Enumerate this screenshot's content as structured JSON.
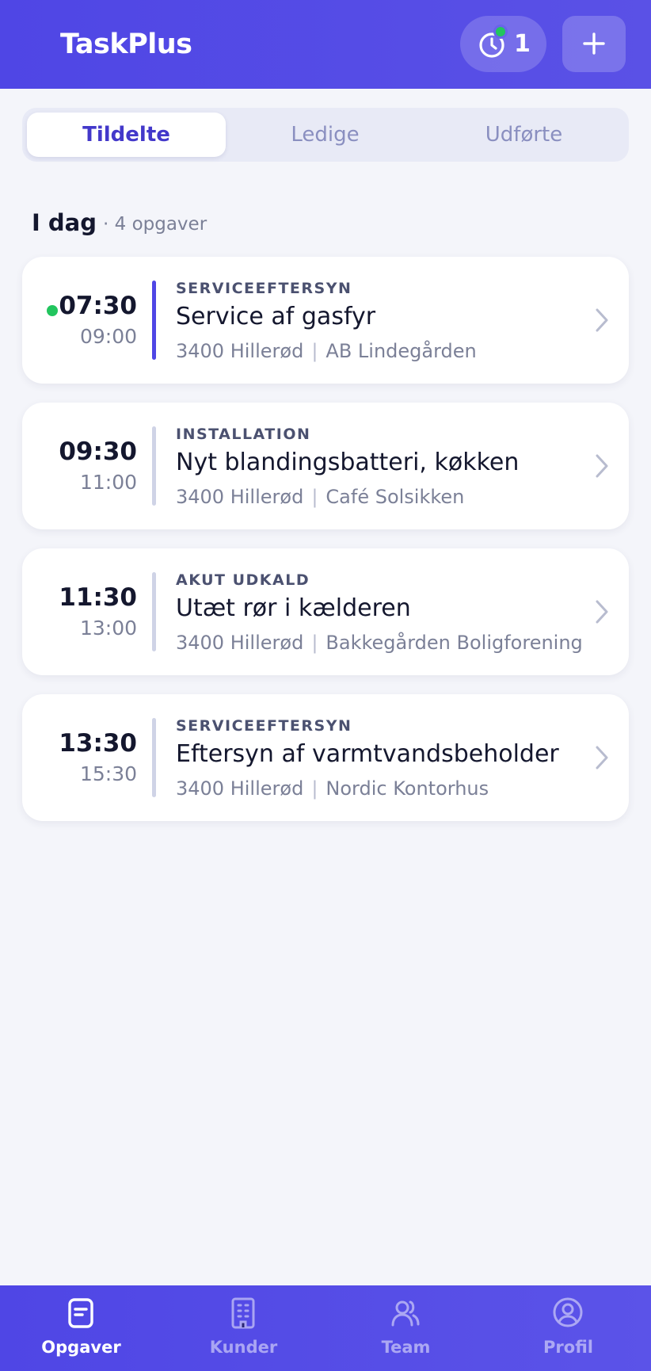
{
  "header": {
    "title": "TaskPlus",
    "timer_count": "1",
    "add_icon": "plus-icon",
    "timer_icon": "clock-icon"
  },
  "tabs": [
    {
      "label": "Tildelte",
      "active": true
    },
    {
      "label": "Ledige",
      "active": false
    },
    {
      "label": "Udførte",
      "active": false
    }
  ],
  "section": {
    "title": "I dag",
    "count": "· 4 opgaver"
  },
  "tasks": [
    {
      "start": "07:30",
      "end": "09:00",
      "category": "SERVICEEFTERSYN",
      "title": "Service af gasfyr",
      "postal": "3400 Hillerød",
      "customer": "AB Lindegården",
      "live": true
    },
    {
      "start": "09:30",
      "end": "11:00",
      "category": "INSTALLATION",
      "title": "Nyt blandingsbatteri, køkken",
      "postal": "3400 Hillerød",
      "customer": "Café Solsikken",
      "live": false
    },
    {
      "start": "11:30",
      "end": "13:00",
      "category": "AKUT UDKALD",
      "title": "Utæt rør i kælderen",
      "postal": "3400 Hillerød",
      "customer": "Bakkegården Boligforening",
      "live": false
    },
    {
      "start": "13:30",
      "end": "15:30",
      "category": "SERVICEEFTERSYN",
      "title": "Eftersyn af varmtvandsbeholder",
      "postal": "3400 Hillerød",
      "customer": "Nordic Kontorhus",
      "live": false
    }
  ],
  "nav": [
    {
      "label": "Opgaver",
      "icon": "clipboard-icon",
      "active": true
    },
    {
      "label": "Kunder",
      "icon": "building-icon",
      "active": false
    },
    {
      "label": "Team",
      "icon": "users-icon",
      "active": false
    },
    {
      "label": "Profil",
      "icon": "user-circle-icon",
      "active": false
    }
  ],
  "colors": {
    "primary": "#4f46e5",
    "live": "#22c55e",
    "background": "#f4f5fa"
  }
}
